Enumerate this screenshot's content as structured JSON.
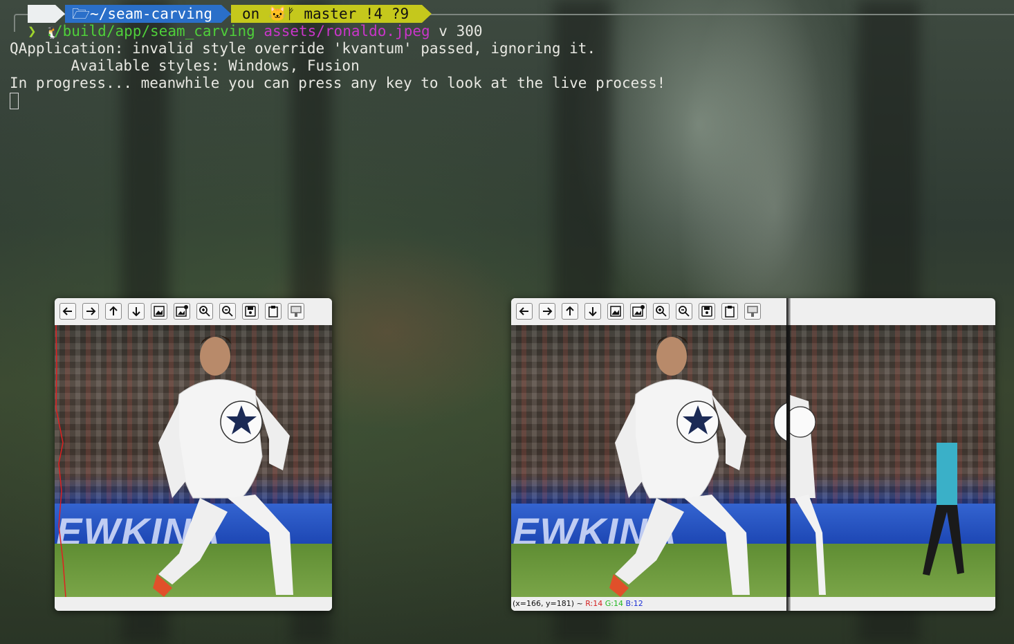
{
  "prompt": {
    "os_icon": "🐧",
    "directory": "~/seam-carving",
    "git_on": "on",
    "git_branch": "master",
    "git_modified": "!4",
    "git_untracked": "?9",
    "prompt_symbol": "❯",
    "command": "./build/app/seam_carving",
    "arg_file": "assets/ronaldo.jpeg",
    "arg_rest": "v 300"
  },
  "output": [
    "QApplication: invalid style override 'kvantum' passed, ignoring it.",
    "       Available styles: Windows, Fusion",
    "In progress... meanwhile you can press any key to look at the live process!"
  ],
  "toolbar_icons": [
    "arrow-left-icon",
    "arrow-right-icon",
    "arrow-up-icon",
    "arrow-down-icon",
    "image-icon",
    "image-settings-icon",
    "zoom-in-icon",
    "zoom-out-icon",
    "save-icon",
    "clipboard-icon",
    "properties-icon"
  ],
  "window_left": {
    "banner_text": "EWKINA"
  },
  "window_right": {
    "banner_text": "EWKINA",
    "status_prefix": "(x=166, y=181) ~ ",
    "status_r": "R:14",
    "status_g": "G:14",
    "status_b": "B:12"
  },
  "colors": {
    "dir_segment": "#2a6fc9",
    "git_segment": "#c5c81c",
    "seam": "#e02020"
  }
}
